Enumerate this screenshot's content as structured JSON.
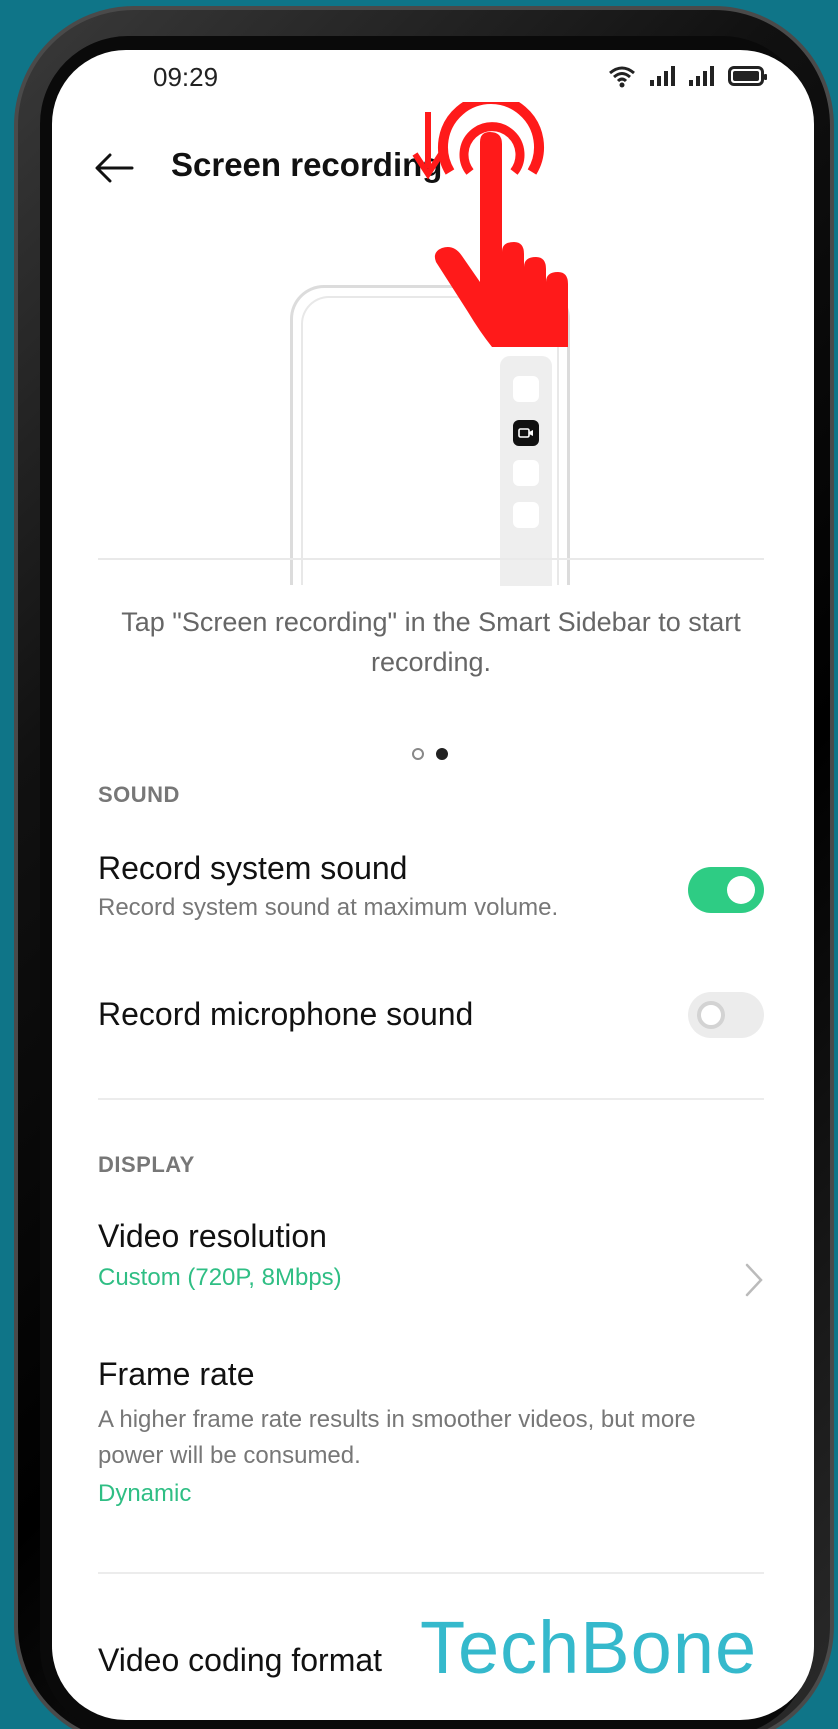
{
  "status": {
    "time": "09:29"
  },
  "header": {
    "title": "Screen recording"
  },
  "illustration": {
    "caption": "Tap \"Screen recording\" in the Smart Sidebar to start recording.",
    "page_count": 2,
    "active_page": 2
  },
  "sections": {
    "sound": {
      "heading": "SOUND",
      "system_sound": {
        "title": "Record system sound",
        "subtitle": "Record system sound at maximum volume.",
        "enabled": true
      },
      "mic_sound": {
        "title": "Record microphone sound",
        "enabled": false
      }
    },
    "display": {
      "heading": "DISPLAY",
      "resolution": {
        "title": "Video resolution",
        "value": "Custom (720P, 8Mbps)"
      },
      "frame_rate": {
        "title": "Frame rate",
        "subtitle": "A higher frame rate results in smoother videos, but more power will be consumed.",
        "value": "Dynamic"
      },
      "coding_format": {
        "title": "Video coding format"
      }
    }
  },
  "watermark": "TechBone",
  "colors": {
    "accent": "#2ecc84",
    "annotation": "#ff1a1a",
    "background": "#0f7588",
    "watermark": "#35b9cc"
  },
  "icons": {
    "back": "arrow-left-icon",
    "chevron": "chevron-right-icon",
    "rec": "video-camera-icon",
    "gesture": "swipe-down-hand-icon"
  }
}
